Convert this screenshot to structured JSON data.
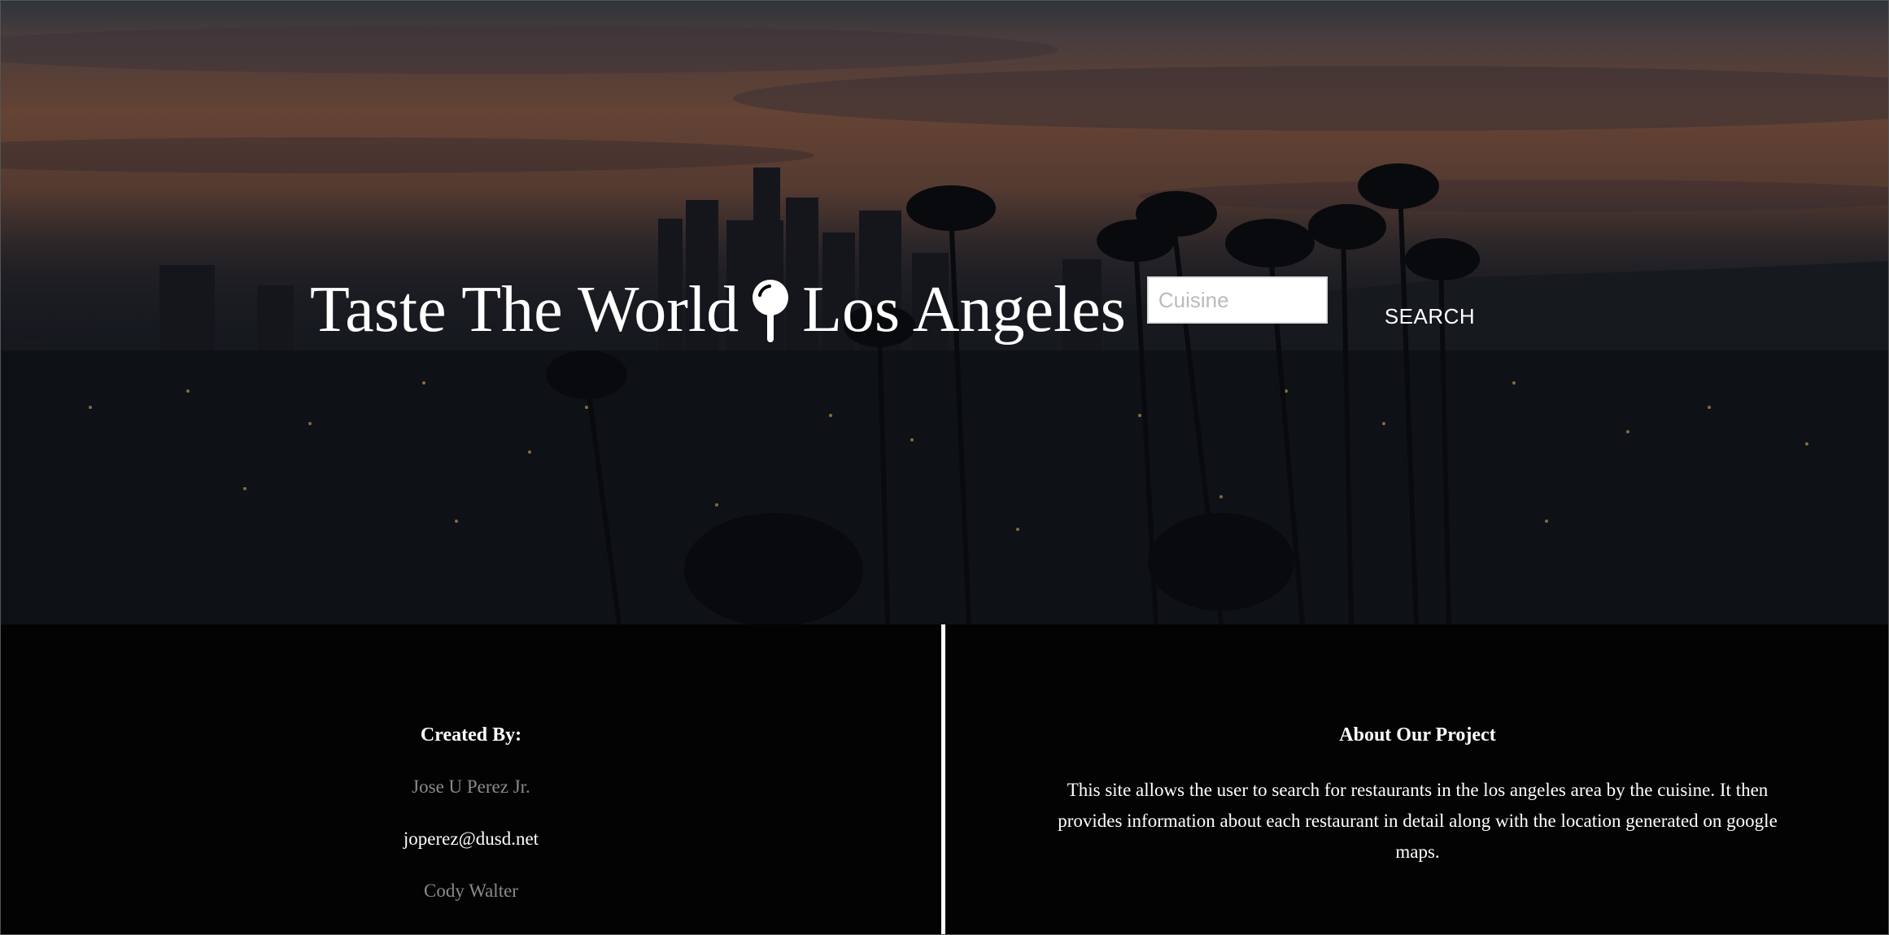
{
  "header": {
    "title_left": "Taste The World",
    "title_right": "Los Angeles",
    "pin_icon": "map-pin-icon"
  },
  "search": {
    "placeholder": "Cuisine",
    "value": "",
    "button_label": "SEARCH"
  },
  "footer": {
    "created_by": {
      "heading": "Created By:",
      "credits": [
        {
          "text": "Jose U Perez Jr.",
          "style": "muted"
        },
        {
          "text": "joperez@dusd.net",
          "style": "white"
        },
        {
          "text": "Cody Walter",
          "style": "muted"
        }
      ]
    },
    "about": {
      "heading": "About Our Project",
      "body": "This site allows the user to search for restaurants in the los angeles area by the cuisine. It then provides information about each restaurant in detail along with the location generated on google maps.",
      "cut_line": "..."
    }
  },
  "colors": {
    "text": "#ffffff",
    "muted": "#8a8a8a",
    "footer_bg": "#030303"
  }
}
